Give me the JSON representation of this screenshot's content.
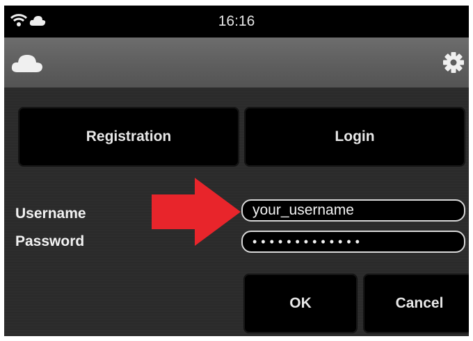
{
  "status_bar": {
    "time": "16:16",
    "icons": [
      "wifi-icon",
      "cloud-icon"
    ]
  },
  "toolbar": {
    "icons": [
      "cloud-icon",
      "gear-icon"
    ]
  },
  "tabs": {
    "registration": "Registration",
    "login": "Login"
  },
  "form": {
    "username_label": "Username",
    "password_label": "Password",
    "username_value": "your_username",
    "password_value": "•••••••••••••"
  },
  "actions": {
    "ok": "OK",
    "cancel": "Cancel"
  },
  "colors": {
    "arrow": "#e8252b",
    "button_bg": "#000000",
    "text": "#f2f2f2"
  }
}
